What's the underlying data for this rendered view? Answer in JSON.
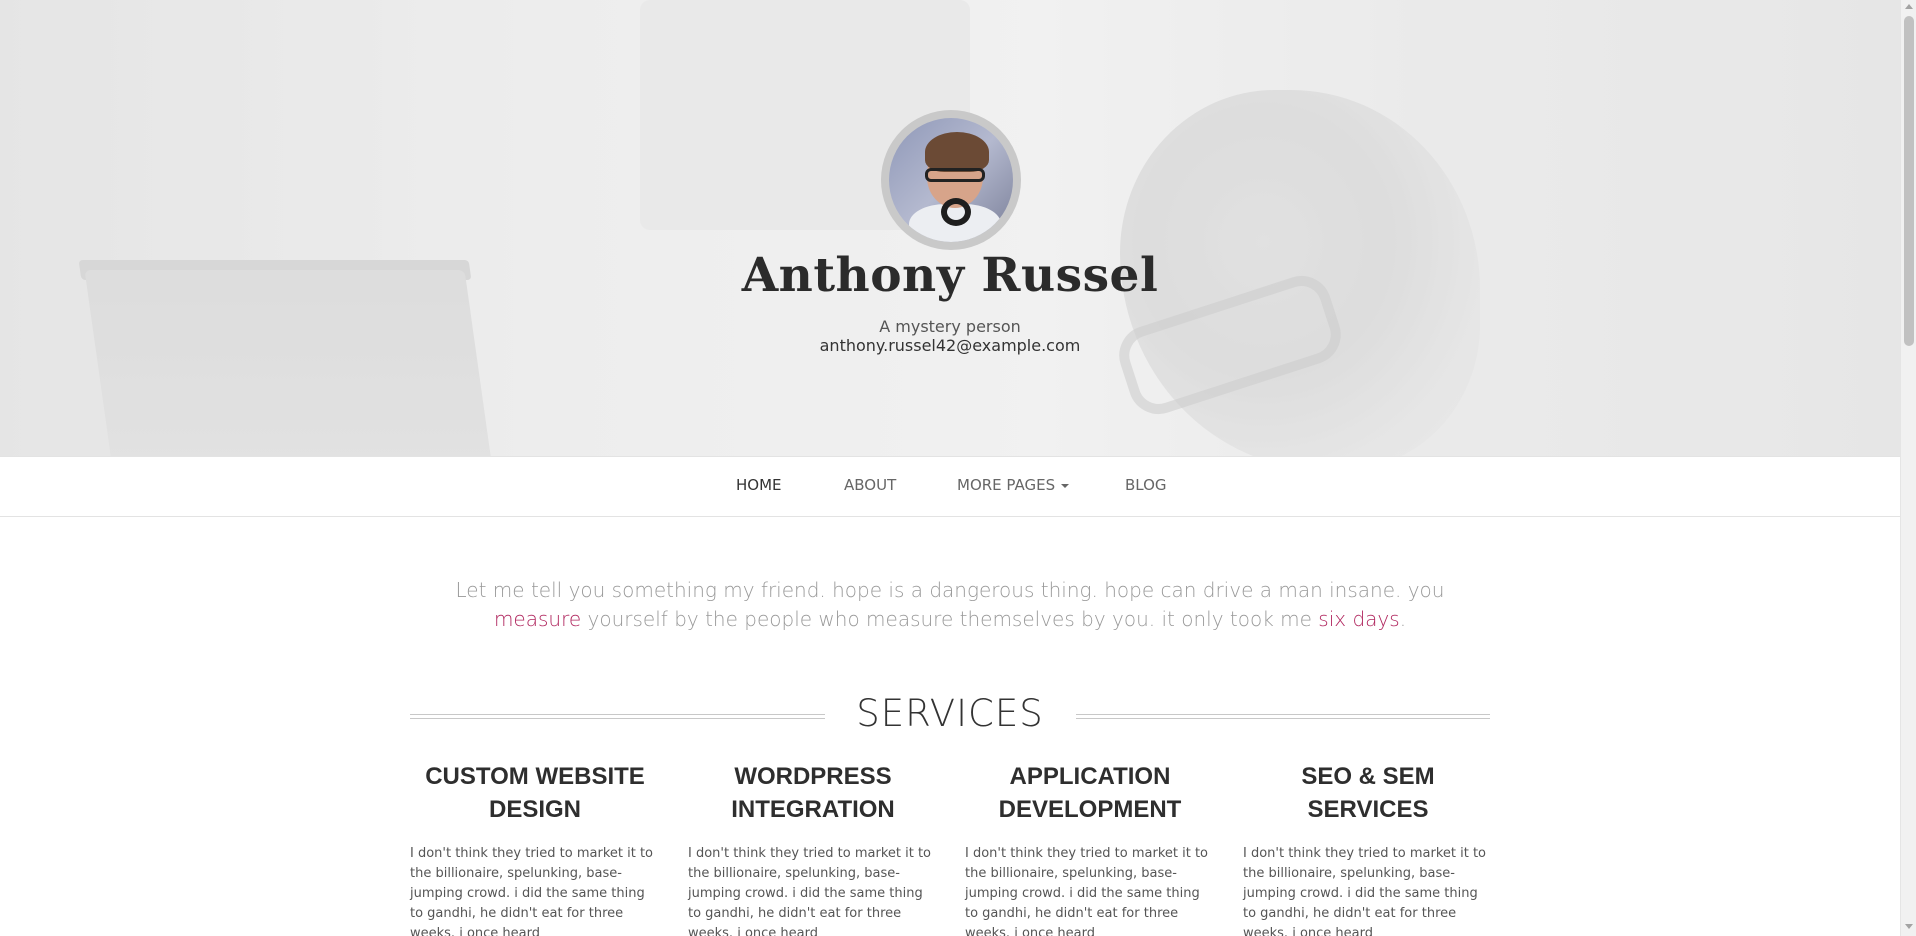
{
  "hero": {
    "name": "Anthony Russel",
    "tagline": "A mystery person",
    "email": "anthony.russel42@example.com"
  },
  "nav": {
    "items": [
      {
        "label": "HOME",
        "active": true
      },
      {
        "label": "ABOUT",
        "active": false
      },
      {
        "label": "MORE PAGES",
        "active": false,
        "dropdown": true
      },
      {
        "label": "BLOG",
        "active": false
      }
    ]
  },
  "intro": {
    "part1": "Let me tell you something my friend. hope is a dangerous thing. hope can drive a man insane. you ",
    "link1": "measure",
    "part2": " yourself by the people who measure themselves by you. it only took me ",
    "link2": "six days",
    "part3": "."
  },
  "services": {
    "heading": "SERVICES",
    "items": [
      {
        "title": "CUSTOM WEBSITE DESIGN",
        "text": "I don't think they tried to market it to the billionaire, spelunking, base-jumping crowd. i did the same thing to gandhi, he didn't eat for three weeks. i once heard"
      },
      {
        "title": "WORDPRESS INTEGRATION",
        "text": "I don't think they tried to market it to the billionaire, spelunking, base-jumping crowd. i did the same thing to gandhi, he didn't eat for three weeks. i once heard"
      },
      {
        "title": "APPLICATION DEVELOPMENT",
        "text": "I don't think they tried to market it to the billionaire, spelunking, base-jumping crowd. i did the same thing to gandhi, he didn't eat for three weeks. i once heard"
      },
      {
        "title": "SEO & SEM SERVICES",
        "text": "I don't think they tried to market it to the billionaire, spelunking, base-jumping crowd. i did the same thing to gandhi, he didn't eat for three weeks. i once heard"
      }
    ]
  },
  "colors": {
    "accent": "#b0265e",
    "text": "#333333",
    "muted": "#999999"
  }
}
